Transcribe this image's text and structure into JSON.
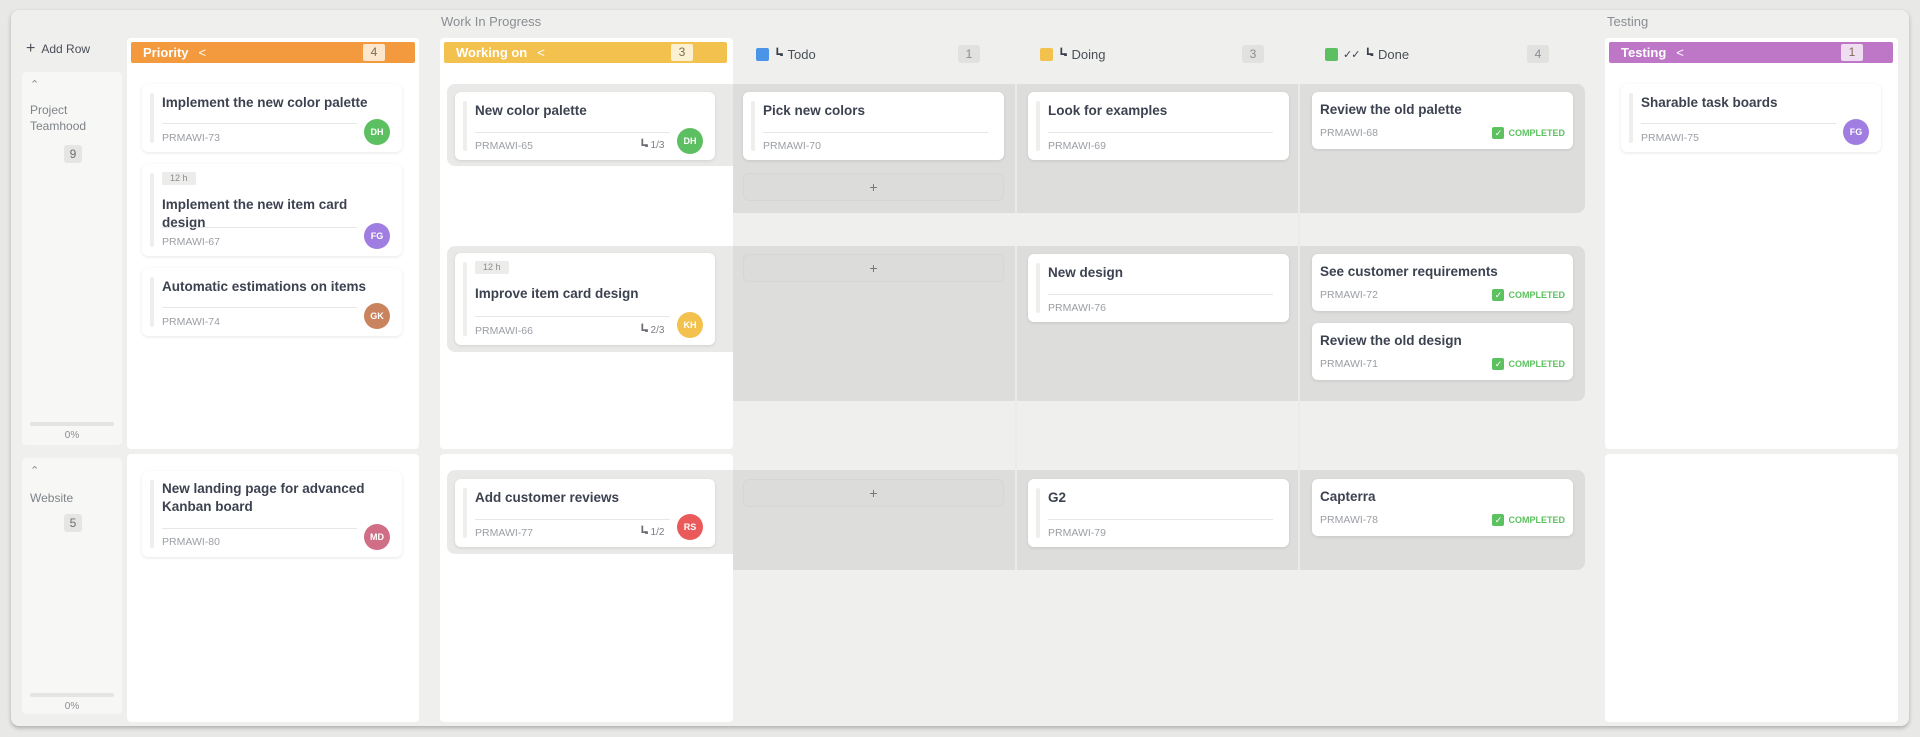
{
  "groups": {
    "wip": "Work In Progress",
    "testing": "Testing"
  },
  "add_row": {
    "label": "Add Row",
    "icon": "plus-icon"
  },
  "rows": [
    {
      "title": "Project Teamhood",
      "count": "9",
      "progress": "0%"
    },
    {
      "title": "Website",
      "count": "5",
      "progress": "0%"
    }
  ],
  "columns": {
    "priority": {
      "label": "Priority",
      "count": "4",
      "color": "#f39a3f"
    },
    "working_on": {
      "label": "Working on",
      "count": "3",
      "color": "#f2c14e"
    },
    "todo": {
      "label": "Todo",
      "count": "1",
      "color": "#4b95e8"
    },
    "doing": {
      "label": "Doing",
      "count": "3",
      "color": "#f2c14e"
    },
    "done": {
      "label": "Done",
      "count": "4",
      "color": "#5cbf61"
    },
    "testing": {
      "label": "Testing",
      "count": "1",
      "color": "#be77c7"
    }
  },
  "add_card_label": "+",
  "completed_label": "COMPLETED",
  "cards": {
    "c73": {
      "title": "Implement the new color palette",
      "id": "PRMAWI-73",
      "avatar": "DH",
      "avatar_color": "#5cbf61"
    },
    "c67": {
      "tag": "12 h",
      "title": "Implement the new item card design",
      "id": "PRMAWI-67",
      "avatar": "FG",
      "avatar_color": "#a07de0"
    },
    "c74": {
      "title": "Automatic estimations on items",
      "id": "PRMAWI-74",
      "avatar": "GK",
      "avatar_color": "#c9845f"
    },
    "c80": {
      "title": "New landing page for advanced Kanban board",
      "id": "PRMAWI-80",
      "avatar": "MD",
      "avatar_color": "#cf6e86"
    },
    "c65": {
      "title": "New color palette",
      "id": "PRMAWI-65",
      "subtasks": "1/3",
      "avatar": "DH",
      "avatar_color": "#5cbf61"
    },
    "c66": {
      "tag": "12 h",
      "title": "Improve item card design",
      "id": "PRMAWI-66",
      "subtasks": "2/3",
      "avatar": "KH",
      "avatar_color": "#f2c14e"
    },
    "c77": {
      "title": "Add customer reviews",
      "id": "PRMAWI-77",
      "subtasks": "1/2",
      "avatar": "RS",
      "avatar_color": "#ea5a5a"
    },
    "c70": {
      "title": "Pick new colors",
      "id": "PRMAWI-70"
    },
    "c69": {
      "title": "Look for examples",
      "id": "PRMAWI-69"
    },
    "c76": {
      "title": "New design",
      "id": "PRMAWI-76"
    },
    "c79": {
      "title": "G2",
      "id": "PRMAWI-79"
    },
    "c68": {
      "title": "Review the old palette",
      "id": "PRMAWI-68"
    },
    "c72": {
      "title": "See customer requirements",
      "id": "PRMAWI-72"
    },
    "c71": {
      "title": "Review the old design",
      "id": "PRMAWI-71"
    },
    "c78": {
      "title": "Capterra",
      "id": "PRMAWI-78"
    },
    "c75": {
      "title": "Sharable task boards",
      "id": "PRMAWI-75",
      "avatar": "FG",
      "avatar_color": "#a07de0"
    }
  }
}
